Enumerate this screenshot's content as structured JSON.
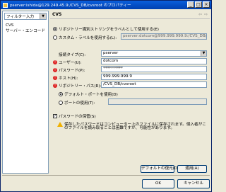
{
  "window": {
    "title": "pserver:ishida@129.249.45.9:/CVS_DB/cvsroot のプロパティー"
  },
  "titlebar": {
    "minimize": "_",
    "maximize": "□",
    "close": "×"
  },
  "sidebar": {
    "filter_placeholder": "フィルター入力",
    "items": [
      {
        "label": "CVS"
      },
      {
        "label": "サーバー・エンコード"
      }
    ]
  },
  "panel": {
    "title": "CVS",
    "nav_back": "⇦",
    "nav_forward": "⇨",
    "label_mode": {
      "option1": "リポジトリー識別ストリングをラベルとして使用する(E)",
      "option2": "カスタム・ラベルを使用する(L):",
      "option2_value": "pserver:dotcom@999.999.999.9:/CVS_DB/"
    },
    "connection_type": {
      "label": "接続タイプ(C):",
      "value": "pserver"
    },
    "user": {
      "label": "ユーザー(U):",
      "value": "dotcom"
    },
    "password": {
      "label": "パスワード(P):",
      "value": "**********"
    },
    "host": {
      "label": "ホスト(H):",
      "value": "999.999.999.9"
    },
    "repo_path": {
      "label": "リポジトリー・パス(R):",
      "value": "/CVS_DB/cvsroot"
    },
    "port": {
      "default": "デフォルト・ポートを使用(D)",
      "custom": "ポートの使用(T):"
    },
    "save_password": {
      "label": "パスワードの保管(S)",
      "warning_line1": "保存したパスワードはコンピューター上のファイルに保存されます。侵入者がこ",
      "warning_line2": "のファイルを読み取ることは困難ですが、可能性があります。"
    },
    "buttons": {
      "restore_defaults": "デフォルトの復元(D)",
      "apply": "適用(A)"
    }
  },
  "footer": {
    "ok": "OK",
    "cancel": "キャンセル"
  }
}
